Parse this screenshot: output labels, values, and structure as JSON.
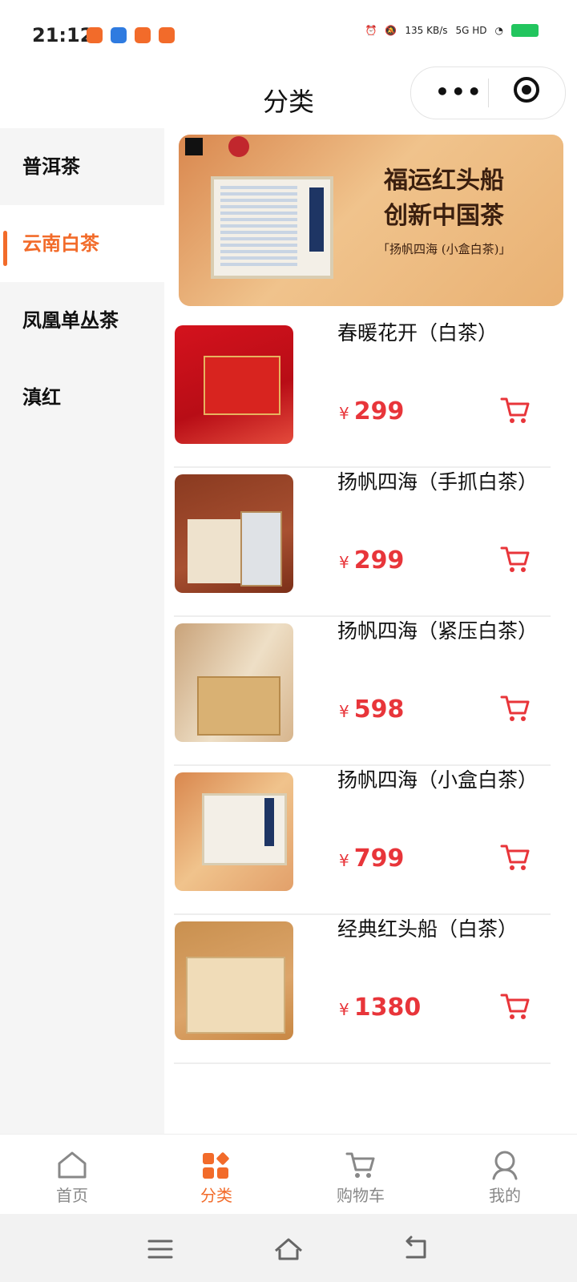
{
  "status": {
    "time": "21:12",
    "speed": "135 KB/s",
    "network": "5G HD"
  },
  "nav": {
    "title": "分类",
    "more_icon": "more-dots-icon",
    "close_icon": "target-icon"
  },
  "sidebar": {
    "items": [
      {
        "label": "普洱茶",
        "active": false
      },
      {
        "label": "云南白茶",
        "active": true
      },
      {
        "label": "凤凰单丛茶",
        "active": false
      },
      {
        "label": "滇红",
        "active": false
      }
    ]
  },
  "banner": {
    "title_line1": "福运红头船",
    "title_line2": "创新中国茶",
    "subtitle": "「扬帆四海 (小盒白茶)」"
  },
  "products": [
    {
      "name": "春暖花开（白茶）",
      "currency": "¥",
      "price": "299"
    },
    {
      "name": "扬帆四海（手抓白茶）",
      "currency": "¥",
      "price": "299"
    },
    {
      "name": "扬帆四海（紧压白茶）",
      "currency": "¥",
      "price": "598"
    },
    {
      "name": "扬帆四海（小盒白茶）",
      "currency": "¥",
      "price": "799"
    },
    {
      "name": "经典红头船（白茶）",
      "currency": "¥",
      "price": "1380"
    }
  ],
  "tabbar": {
    "items": [
      {
        "label": "首页",
        "icon": "home-icon"
      },
      {
        "label": "分类",
        "icon": "category-icon",
        "active": true
      },
      {
        "label": "购物车",
        "icon": "cart-icon"
      },
      {
        "label": "我的",
        "icon": "profile-icon"
      }
    ]
  },
  "colors": {
    "accent": "#f26b2a",
    "price": "#e8353a"
  }
}
